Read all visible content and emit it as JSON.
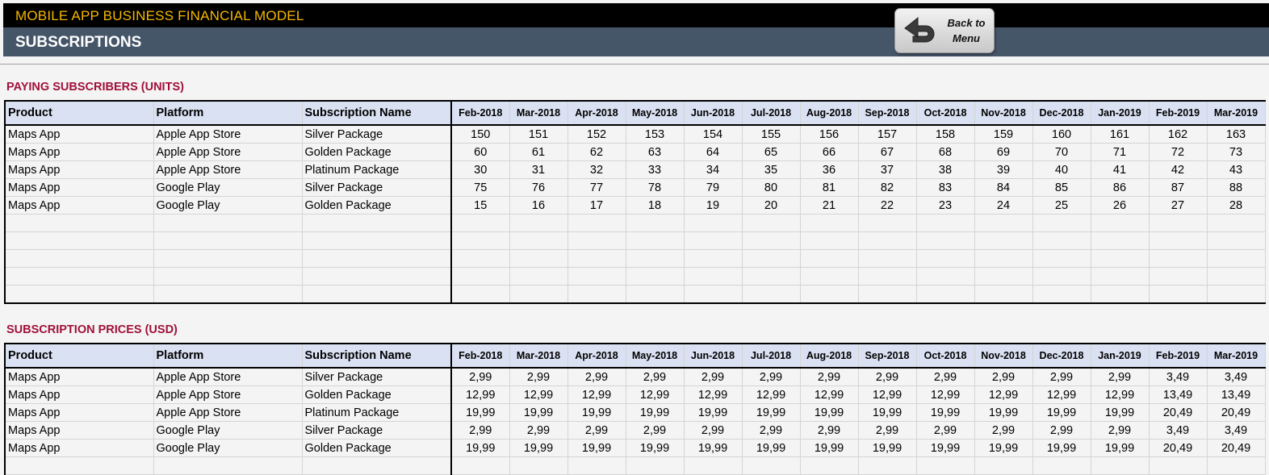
{
  "header": {
    "app_title": "MOBILE APP BUSINESS FINANCIAL MODEL",
    "page_title": "SUBSCRIPTIONS",
    "back_button": {
      "line1": "Back to",
      "line2": "Menu",
      "icon": "back-arrow-icon"
    }
  },
  "colors": {
    "title_accent": "#f5b800",
    "section_title": "#a0103a",
    "header_fill": "#dae1f2",
    "slate_bar": "#465669"
  },
  "columns": {
    "product": "Product",
    "platform": "Platform",
    "subscription_name": "Subscription Name",
    "months": [
      "Feb-2018",
      "Mar-2018",
      "Apr-2018",
      "May-2018",
      "Jun-2018",
      "Jul-2018",
      "Aug-2018",
      "Sep-2018",
      "Oct-2018",
      "Nov-2018",
      "Dec-2018",
      "Jan-2019",
      "Feb-2019",
      "Mar-2019"
    ]
  },
  "subscribers": {
    "title": "PAYING SUBSCRIBERS (UNITS)",
    "rows": [
      {
        "product": "Maps App",
        "platform": "Apple App Store",
        "name": "Silver Package",
        "values": [
          "150",
          "151",
          "152",
          "153",
          "154",
          "155",
          "156",
          "157",
          "158",
          "159",
          "160",
          "161",
          "162",
          "163"
        ]
      },
      {
        "product": "Maps App",
        "platform": "Apple App Store",
        "name": "Golden Package",
        "values": [
          "60",
          "61",
          "62",
          "63",
          "64",
          "65",
          "66",
          "67",
          "68",
          "69",
          "70",
          "71",
          "72",
          "73"
        ]
      },
      {
        "product": "Maps App",
        "platform": "Apple App Store",
        "name": "Platinum Package",
        "values": [
          "30",
          "31",
          "32",
          "33",
          "34",
          "35",
          "36",
          "37",
          "38",
          "39",
          "40",
          "41",
          "42",
          "43"
        ]
      },
      {
        "product": "Maps App",
        "platform": "Google Play",
        "name": "Silver Package",
        "values": [
          "75",
          "76",
          "77",
          "78",
          "79",
          "80",
          "81",
          "82",
          "83",
          "84",
          "85",
          "86",
          "87",
          "88"
        ]
      },
      {
        "product": "Maps App",
        "platform": "Google Play",
        "name": "Golden Package",
        "values": [
          "15",
          "16",
          "17",
          "18",
          "19",
          "20",
          "21",
          "22",
          "23",
          "24",
          "25",
          "26",
          "27",
          "28"
        ]
      }
    ],
    "empty_rows": 5
  },
  "prices": {
    "title": "SUBSCRIPTION PRICES (USD)",
    "rows": [
      {
        "product": "Maps App",
        "platform": "Apple App Store",
        "name": "Silver Package",
        "values": [
          "2,99",
          "2,99",
          "2,99",
          "2,99",
          "2,99",
          "2,99",
          "2,99",
          "2,99",
          "2,99",
          "2,99",
          "2,99",
          "2,99",
          "3,49",
          "3,49"
        ]
      },
      {
        "product": "Maps App",
        "platform": "Apple App Store",
        "name": "Golden Package",
        "values": [
          "12,99",
          "12,99",
          "12,99",
          "12,99",
          "12,99",
          "12,99",
          "12,99",
          "12,99",
          "12,99",
          "12,99",
          "12,99",
          "12,99",
          "13,49",
          "13,49"
        ]
      },
      {
        "product": "Maps App",
        "platform": "Apple App Store",
        "name": "Platinum Package",
        "values": [
          "19,99",
          "19,99",
          "19,99",
          "19,99",
          "19,99",
          "19,99",
          "19,99",
          "19,99",
          "19,99",
          "19,99",
          "19,99",
          "19,99",
          "20,49",
          "20,49"
        ]
      },
      {
        "product": "Maps App",
        "platform": "Google Play",
        "name": "Silver Package",
        "values": [
          "2,99",
          "2,99",
          "2,99",
          "2,99",
          "2,99",
          "2,99",
          "2,99",
          "2,99",
          "2,99",
          "2,99",
          "2,99",
          "2,99",
          "3,49",
          "3,49"
        ]
      },
      {
        "product": "Maps App",
        "platform": "Google Play",
        "name": "Golden Package",
        "values": [
          "19,99",
          "19,99",
          "19,99",
          "19,99",
          "19,99",
          "19,99",
          "19,99",
          "19,99",
          "19,99",
          "19,99",
          "19,99",
          "19,99",
          "20,49",
          "20,49"
        ]
      }
    ],
    "empty_rows": 1
  }
}
